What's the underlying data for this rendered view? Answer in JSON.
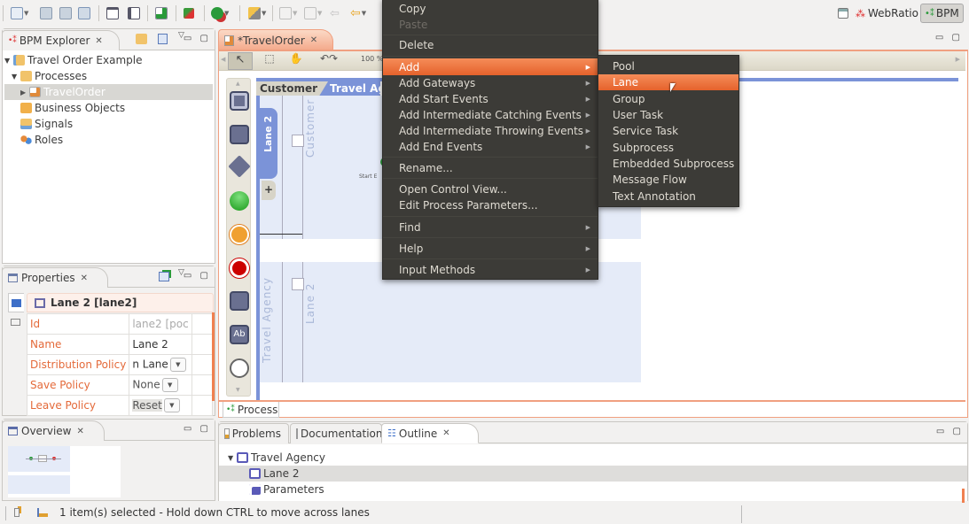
{
  "toolbar": {
    "perspectives": [
      {
        "icon": "webratio-icon",
        "label": "WebRatio"
      },
      {
        "icon": "bpm-icon",
        "label": "BPM"
      }
    ]
  },
  "explorer": {
    "tab_label": "BPM Explorer",
    "tree": [
      {
        "label": "Travel Order Example",
        "icon": "project-icon",
        "level": 0,
        "expanded": true
      },
      {
        "label": "Processes",
        "icon": "folder-icon",
        "level": 1,
        "expanded": true
      },
      {
        "label": "TravelOrder",
        "icon": "process-icon",
        "level": 2,
        "selected": true
      },
      {
        "label": "Business Objects",
        "icon": "folder-icon",
        "level": 1
      },
      {
        "label": "Signals",
        "icon": "signals-icon",
        "level": 1
      },
      {
        "label": "Roles",
        "icon": "roles-icon",
        "level": 1
      }
    ]
  },
  "properties": {
    "tab_label": "Properties",
    "header": "Lane 2 [lane2]",
    "rows": [
      {
        "key": "Id",
        "value": "lane2  [poc"
      },
      {
        "key": "Name",
        "value": "Lane 2"
      },
      {
        "key": "Distribution Policy",
        "value": "n Lane",
        "combo": true
      },
      {
        "key": "Save Policy",
        "value": "None",
        "combo": true
      },
      {
        "key": "Leave Policy",
        "value": "Reset",
        "combo": true
      }
    ]
  },
  "overview": {
    "tab_label": "Overview"
  },
  "editor": {
    "tab_label": "*TravelOrder",
    "zoom": "100 %",
    "pools": {
      "customer_label": "Customer",
      "travel_label": "Travel Agency",
      "lane_tab": "Lane 2",
      "lane_customer_1": "Customer",
      "lane_customer_2": "Customer",
      "lane_travel_1": "Travel Agency",
      "lane_travel_2": "Lane 2",
      "start_label": "Start E"
    },
    "bottom_tab": "Process"
  },
  "context_menu": {
    "items": [
      {
        "label": "Copy"
      },
      {
        "label": "Paste",
        "disabled": true
      },
      {
        "sep": true
      },
      {
        "label": "Delete"
      },
      {
        "sep": true
      },
      {
        "label": "Add",
        "submenu": true,
        "highlighted": true
      },
      {
        "label": "Add Gateways",
        "submenu": true
      },
      {
        "label": "Add Start Events",
        "submenu": true
      },
      {
        "label": "Add Intermediate Catching Events",
        "submenu": true
      },
      {
        "label": "Add Intermediate Throwing Events",
        "submenu": true
      },
      {
        "label": "Add End Events",
        "submenu": true
      },
      {
        "sep": true
      },
      {
        "label": "Rename..."
      },
      {
        "sep": true
      },
      {
        "label": "Open Control View..."
      },
      {
        "label": "Edit Process Parameters..."
      },
      {
        "sep": true
      },
      {
        "label": "Find",
        "submenu": true
      },
      {
        "sep": true
      },
      {
        "label": "Help",
        "submenu": true
      },
      {
        "sep": true
      },
      {
        "label": "Input Methods",
        "submenu": true
      }
    ]
  },
  "submenu": {
    "items": [
      "Pool",
      "Lane",
      "Group",
      "User Task",
      "Service Task",
      "Subprocess",
      "Embedded Subprocess",
      "Message Flow",
      "Text Annotation"
    ],
    "highlighted": "Lane"
  },
  "bottom_panel": {
    "tabs": [
      "Problems",
      "Documentation",
      "Outline"
    ],
    "active_tab": "Outline",
    "outline": [
      {
        "label": "Travel Agency",
        "level": 0,
        "expanded": true
      },
      {
        "label": "Lane 2",
        "level": 1,
        "selected": true
      },
      {
        "label": "Parameters",
        "level": 1
      }
    ]
  },
  "status": {
    "message": "1 item(s) selected - Hold down CTRL to move across lanes"
  },
  "colors": {
    "accent": "#e5622c",
    "menu_bg": "#3c3b37",
    "pool_blue": "#7b93d8",
    "lane_bg": "#e5ebf8"
  }
}
